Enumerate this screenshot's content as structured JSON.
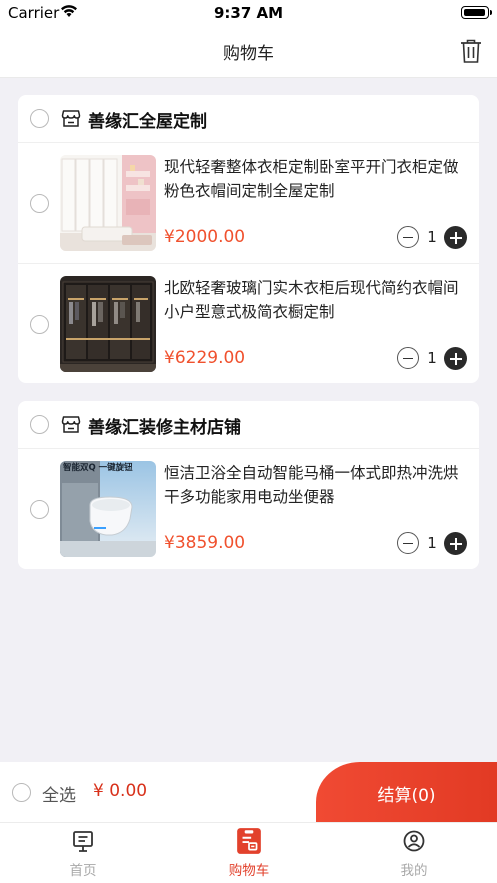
{
  "status_bar": {
    "carrier": "Carrier",
    "time": "9:37 AM"
  },
  "nav": {
    "title": "购物车",
    "delete_icon": "trash-icon"
  },
  "shops": [
    {
      "name": "善缘汇全屋定制",
      "icon": "store-icon",
      "items": [
        {
          "name": "现代轻奢整体衣柜定制卧室平开门衣柜定做粉色衣帽间定制全屋定制",
          "price": "¥2000.00",
          "quantity": "1"
        },
        {
          "name": "北欧轻奢玻璃门实木衣柜后现代简约衣帽间小户型意式极简衣橱定制",
          "price": "¥6229.00",
          "quantity": "1"
        }
      ]
    },
    {
      "name": "善缘汇装修主材店铺",
      "icon": "store-icon",
      "items": [
        {
          "name": "恒洁卫浴全自动智能马桶一体式即热冲洗烘干多功能家用电动坐便器",
          "price": "¥3859.00",
          "quantity": "1",
          "image_text": "智能双Q 一键旋钮"
        }
      ]
    }
  ],
  "footer": {
    "select_all": "全选",
    "total": "¥ 0.00",
    "checkout": "结算(0)"
  },
  "tabs": [
    {
      "label": "首页",
      "icon": "home-icon",
      "active": false
    },
    {
      "label": "购物车",
      "icon": "cart-icon",
      "active": true
    },
    {
      "label": "我的",
      "icon": "profile-icon",
      "active": false
    }
  ],
  "colors": {
    "accent": "#e2412c",
    "price": "#f0512e",
    "background": "#f1f0f5"
  }
}
